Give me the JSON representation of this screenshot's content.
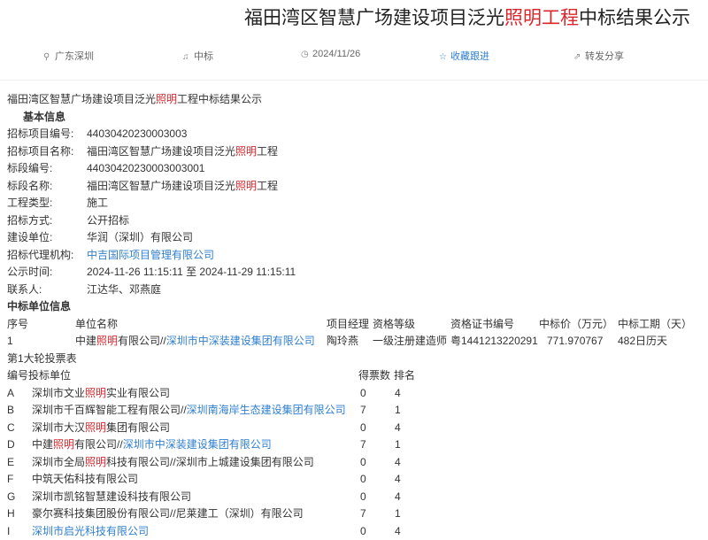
{
  "title": {
    "part1": "福田湾区智慧广场建设项目泛光",
    "highlight": "照明工程",
    "part2": "中标结果公示"
  },
  "meta": {
    "region": "广东深圳",
    "type": "中标",
    "date": "2024/11/26",
    "favorite": "收藏跟进",
    "share": "转发分享",
    "icons": [
      "location-pin-icon",
      "bell-icon",
      "clock-icon",
      "star-icon",
      "share-icon"
    ]
  },
  "doc": {
    "heading_a": "福田湾区智慧广场建设项目泛光",
    "heading_red": "照明",
    "heading_b": "工程中标结果公示",
    "basic_title": "基本信息",
    "fields": {
      "project_no_label": "招标项目编号:",
      "project_no": "44030420230003003",
      "project_name_label": "招标项目名称:",
      "project_name_a": "福田湾区智慧广场建设项目泛光",
      "project_name_red": "照明",
      "project_name_b": "工程",
      "section_no_label": "标段编号:",
      "section_no": "44030420230003003001",
      "section_name_label": "标段名称:",
      "section_name_a": "福田湾区智慧广场建设项目泛光",
      "section_name_red": "照明",
      "section_name_b": "工程",
      "work_type_label": "工程类型:",
      "work_type": "施工",
      "method_label": "招标方式:",
      "method": "公开招标",
      "owner_label": "建设单位:",
      "owner": "华润（深圳）有限公司",
      "agent_label": "招标代理机构:",
      "agent": "中吉国际项目管理有限公司",
      "publish_label": "公示时间:",
      "publish": "2024-11-26 11:15:11 至 2024-11-29 11:15:11",
      "contact_label": "联系人:",
      "contact": "江达华、邓燕庭"
    },
    "winner_title": "中标单位信息",
    "winner_headers": {
      "no": "序号",
      "unit": "单位名称",
      "manager": "项目经理",
      "qual": "资格等级",
      "cert": "资格证书编号",
      "price": "中标价（万元）",
      "period": "中标工期（天）"
    },
    "winner_row": {
      "no": "1",
      "unit_a": "中建",
      "unit_red": "照明",
      "unit_b": "有限公司//",
      "unit_link": "深圳市中深装建设集团有限公司",
      "manager": "陶玲燕",
      "qual": "一级注册建造师",
      "cert": "粤1441213220291",
      "price": "771.970767",
      "period": "482日历天"
    },
    "vote_title": "第1大轮投票表",
    "vote_headers": {
      "code": "编号",
      "unit": "投标单位",
      "votes": "得票数",
      "rank": "排名"
    },
    "vote_rows": [
      {
        "code": "A",
        "a": "深圳市文业",
        "red": "照明",
        "b": "实业有限公司",
        "link": "",
        "votes": "0",
        "rank": "4"
      },
      {
        "code": "B",
        "a": "深圳市千百辉智能工程有限公司//",
        "red": "",
        "b": "",
        "link": "深圳南海岸生态建设集团有限公司",
        "votes": "7",
        "rank": "1"
      },
      {
        "code": "C",
        "a": "深圳市大汉",
        "red": "照明",
        "b": "集团有限公司",
        "link": "",
        "votes": "0",
        "rank": "4"
      },
      {
        "code": "D",
        "a": "中建",
        "red": "照明",
        "b": "有限公司//",
        "link": "深圳市中深装建设集团有限公司",
        "votes": "7",
        "rank": "1"
      },
      {
        "code": "E",
        "a": "深圳市全局",
        "red": "照明",
        "b": "科技有限公司//深圳市上城建设集团有限公司",
        "link": "",
        "votes": "0",
        "rank": "4"
      },
      {
        "code": "F",
        "a": "中筑天佑科技有限公司",
        "red": "",
        "b": "",
        "link": "",
        "votes": "0",
        "rank": "4"
      },
      {
        "code": "G",
        "a": "深圳市凯铭智慧建设科技有限公司",
        "red": "",
        "b": "",
        "link": "",
        "votes": "0",
        "rank": "4"
      },
      {
        "code": "H",
        "a": "豪尔赛科技集团股份有限公司//尼莱建工（深圳）有限公司",
        "red": "",
        "b": "",
        "link": "",
        "votes": "7",
        "rank": "1"
      },
      {
        "code": "I",
        "a": "",
        "red": "",
        "b": "",
        "link": "深圳市启光科技有限公司",
        "votes": "0",
        "rank": "4"
      }
    ]
  },
  "colors": {
    "accent_red": "#d9272e",
    "link_blue": "#2f7fd0"
  }
}
